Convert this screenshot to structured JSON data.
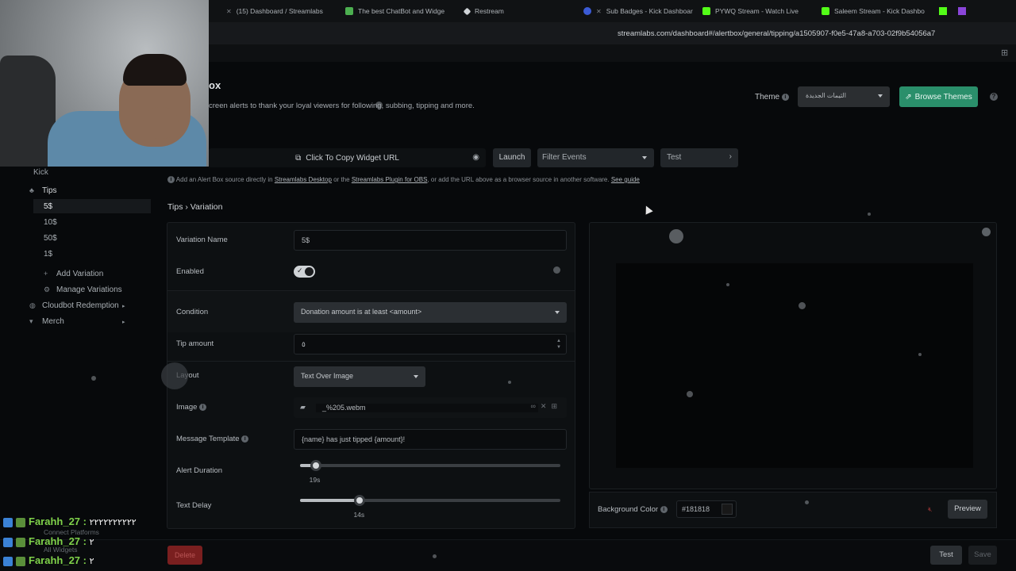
{
  "browser": {
    "tabs": [
      {
        "title": "(15) Dashboard / Streamlabs",
        "color": "#4caf50"
      },
      {
        "title": "The best ChatBot and Widge",
        "color": "#4caf50"
      },
      {
        "title": "Restream",
        "color": "#cfd3d7"
      },
      {
        "title": "Sub Badges - Kick Dashboar",
        "color": "#3b5bd6"
      },
      {
        "title": "PYWQ Stream - Watch Live",
        "color": "#53fc18"
      },
      {
        "title": "Saleem Stream - Kick Dashbo",
        "color": "#53fc18"
      }
    ],
    "url": "streamlabs.com/dashboard#/alertbox/general/tipping/a1505907-f0e5-47a8-a703-02f9b54056a7"
  },
  "header": {
    "title": "ox",
    "subtitle": "creen alerts to thank your loyal viewers for following, subbing, tipping and more.",
    "theme_label": "Theme",
    "theme_value": "الثيمات الجديدة",
    "browse_themes": "Browse Themes"
  },
  "toolbar": {
    "copy_url": "Click To Copy Widget URL",
    "launch": "Launch",
    "filter_events": "Filter Events",
    "test": "Test",
    "note_prefix": "Add an Alert Box source directly in",
    "note_link1": "Streamlabs Desktop",
    "note_mid": "or the",
    "note_link2": "Streamlabs Plugin for OBS",
    "note_suffix": ", or add the URL above as a browser source in another software.",
    "note_link3": "See guide"
  },
  "sidebar": {
    "kick": "Kick",
    "tips": "Tips",
    "variations": [
      "5$",
      "10$",
      "50$",
      "1$"
    ],
    "add_variation": "Add Variation",
    "manage_variations": "Manage Variations",
    "cloudbot": "Cloudbot Redemption",
    "merch": "Merch"
  },
  "breadcrumb": {
    "root": "Tips",
    "sep": "›",
    "current": "Variation"
  },
  "form": {
    "variation_name_label": "Variation Name",
    "variation_name_value": "5$",
    "enabled_label": "Enabled",
    "enabled": true,
    "condition_label": "Condition",
    "condition_value": "Donation amount is at least <amount>",
    "tip_amount_label": "Tip amount",
    "tip_amount_value": "٥",
    "layout_label": "Layout",
    "layout_value": "Text Over Image",
    "image_label": "Image",
    "image_value": "_%205.webm",
    "message_template_label": "Message Template",
    "message_template_value": "{name} has just tipped {amount}!",
    "alert_duration_label": "Alert Duration",
    "alert_duration_value": "19s",
    "alert_duration_fraction": 0.06,
    "text_delay_label": "Text Delay",
    "text_delay_value": "14s",
    "text_delay_fraction": 0.23
  },
  "preview": {
    "bg_color_label": "Background Color",
    "bg_color_value": "#181818",
    "preview_button": "Preview"
  },
  "footer": {
    "delete": "Delete",
    "test": "Test",
    "save": "Save"
  },
  "chat": [
    {
      "user": "Farahh_27",
      "sep": " : ",
      "msg": "٢٢٢٢٢٢٢٢٢٢"
    },
    {
      "user": "Farahh_27",
      "sep": " : ",
      "msg": "٢"
    },
    {
      "user": "Farahh_27",
      "sep": " : ",
      "msg": "٢"
    }
  ],
  "ghost_menu": {
    "connect": "Connect Platforms",
    "all_widgets": "All Widgets"
  },
  "colors": {
    "accent_green": "#2a8f6b",
    "delete_red": "#7a1f1f",
    "chat_name": "#7fd14a"
  }
}
